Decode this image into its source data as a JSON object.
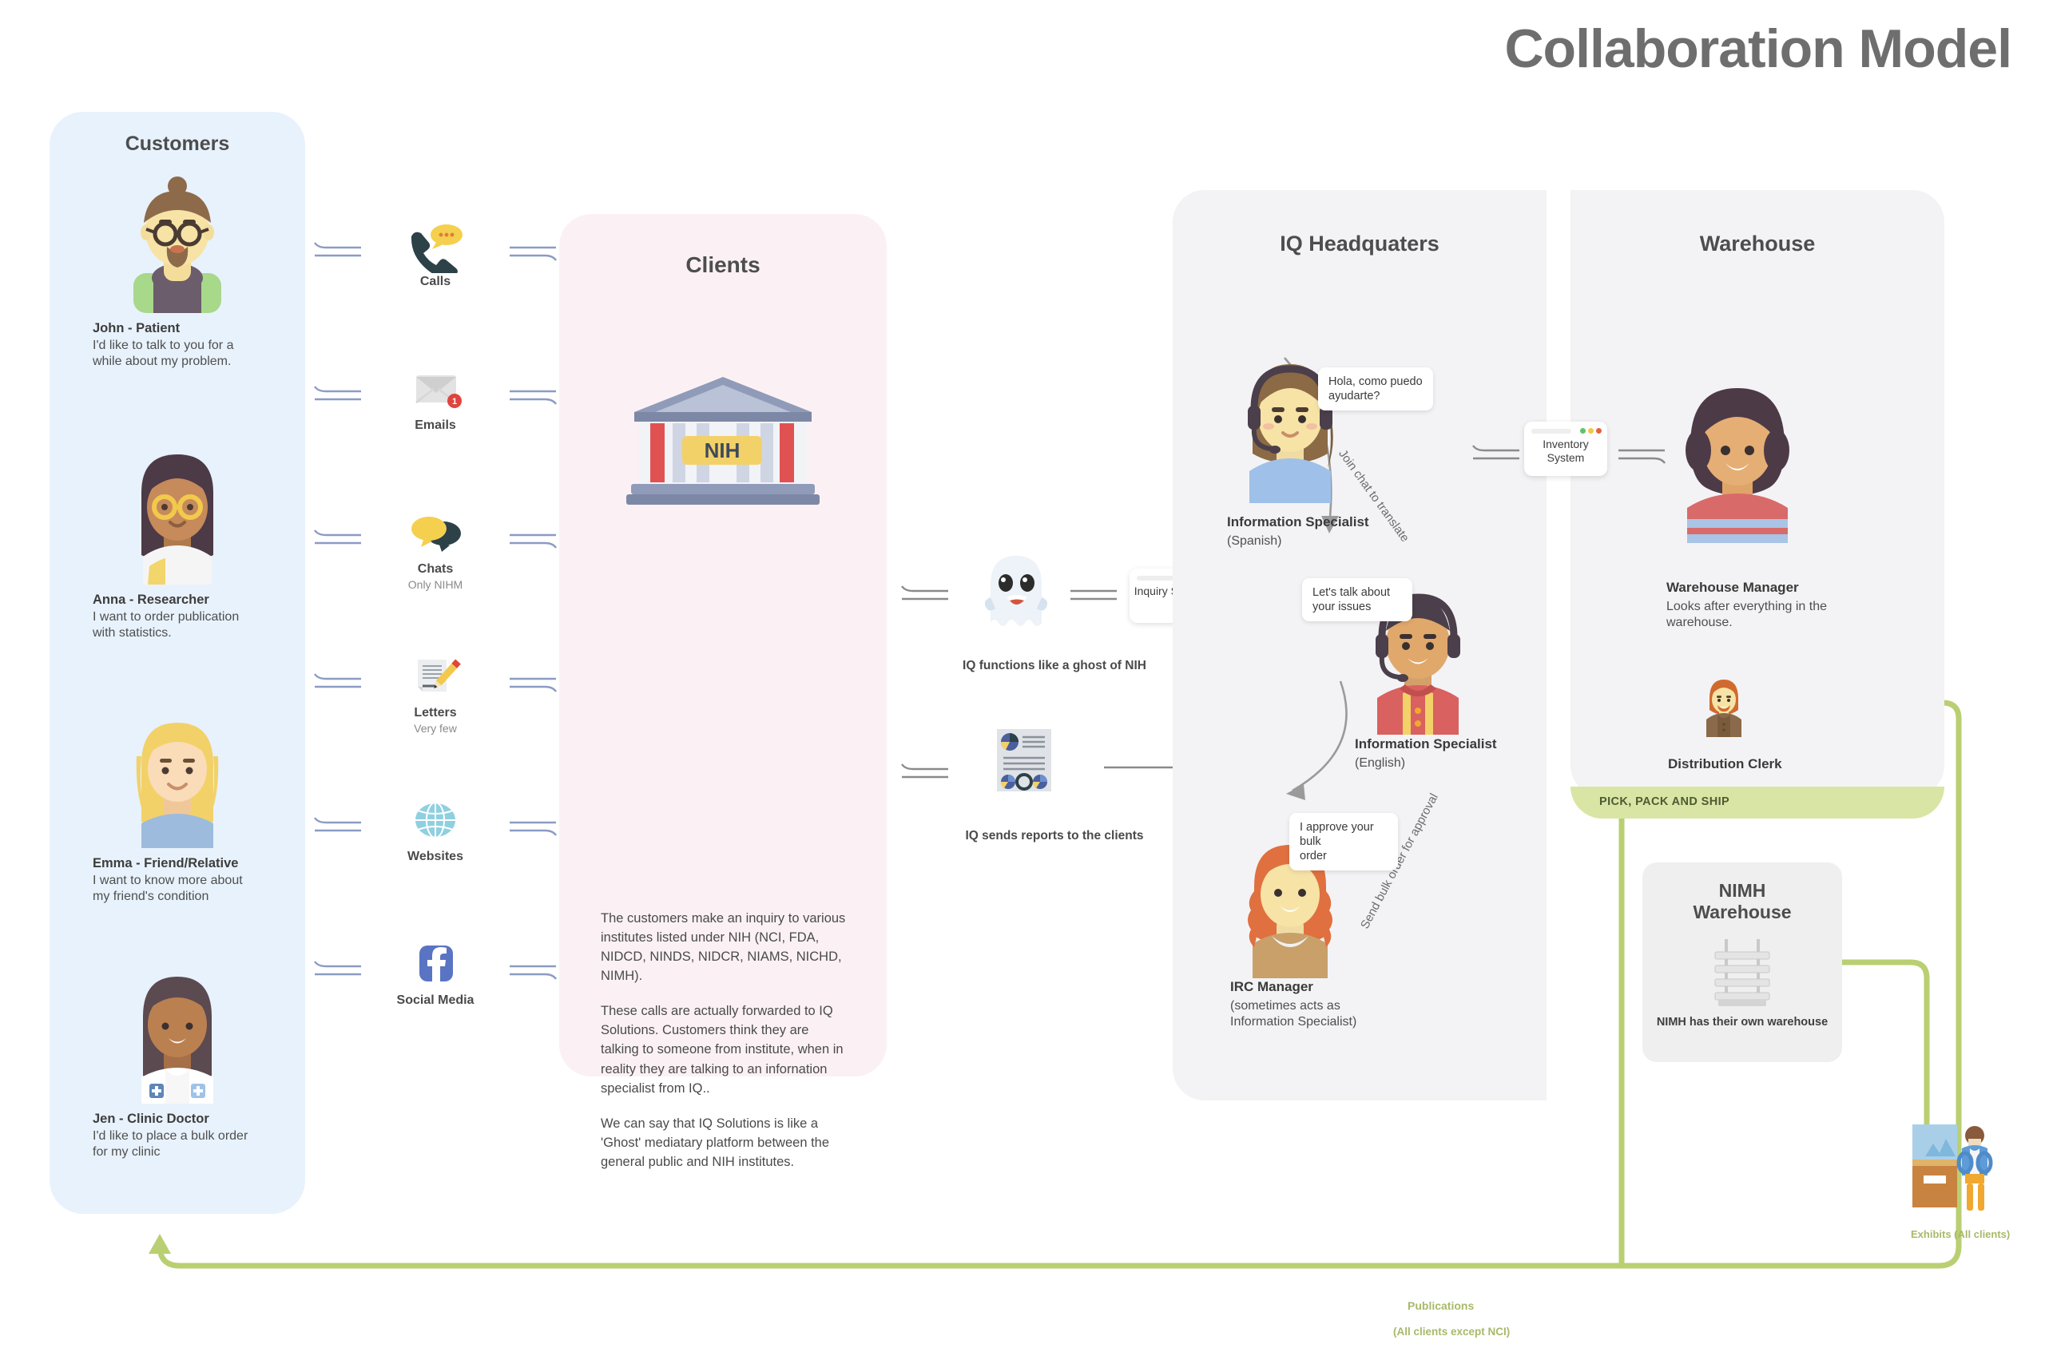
{
  "title": "Collaboration Model",
  "customers": {
    "heading": "Customers",
    "items": [
      {
        "name": "John - Patient",
        "desc": "I'd like to talk to you for a while about my problem.",
        "avatar": "john-avatar"
      },
      {
        "name": "Anna - Researcher",
        "desc": "I want to order publication with statistics.",
        "avatar": "anna-avatar"
      },
      {
        "name": "Emma - Friend/Relative",
        "desc": "I want to know more about my friend's condition",
        "avatar": "emma-avatar"
      },
      {
        "name": "Jen - Clinic Doctor",
        "desc": "I'd like to place a bulk order for my clinic",
        "avatar": "jen-avatar"
      }
    ]
  },
  "channels": [
    {
      "label": "Calls",
      "sub": "",
      "icon": "phone-icon"
    },
    {
      "label": "Emails",
      "sub": "",
      "icon": "envelope-icon"
    },
    {
      "label": "Chats",
      "sub": "Only NIHM",
      "icon": "chat-bubbles-icon"
    },
    {
      "label": "Letters",
      "sub": "Very few",
      "icon": "letter-pencil-icon"
    },
    {
      "label": "Websites",
      "sub": "",
      "icon": "globe-icon"
    },
    {
      "label": "Social Media",
      "sub": "",
      "icon": "facebook-icon"
    }
  ],
  "clients": {
    "heading": "Clients",
    "building_label": "NIH",
    "paragraphs": [
      "The customers make an inquiry to various institutes listed under NIH (NCI, FDA, NIDCD, NINDS, NIDCR, NIAMS, NICHD, NIMH).",
      "These calls are actually forwarded to IQ Solutions. Customers think they are talking to someone from institute, when in reality they are talking to an infornation specialist from IQ..",
      "We can say that IQ Solutions is like a 'Ghost' mediatary platform between the general public and NIH institutes."
    ],
    "ghost_quote": "'Ghost'"
  },
  "middle": {
    "ghost_caption": "IQ functions like a ghost of NIH",
    "inquiry_system": "Inquiry\nSystem",
    "reports_caption": "IQ sends reports to the clients"
  },
  "headquarters": {
    "heading": "IQ Headquaters",
    "specialist_spanish": {
      "name": "Information Specialist",
      "sub": "(Spanish)",
      "bubble": "Hola, como puedo\nayudarte?"
    },
    "specialist_english": {
      "name": "Information Specialist",
      "sub": "(English)",
      "bubble": "Let's talk about\nyour issues"
    },
    "irc_manager": {
      "name": "IRC Manager",
      "sub": "(sometimes acts as\nInformation Specialist)",
      "bubble": "I approve your bulk\norder"
    },
    "arrow_translate": "Join chat to translate",
    "arrow_bulk": "Send bulk order for approval"
  },
  "warehouse": {
    "heading": "Warehouse",
    "inventory_system": "Inventory\nSystem",
    "manager": {
      "name": "Warehouse Manager",
      "desc": "Looks after everything in the warehouse."
    },
    "clerk": {
      "name": "Distribution Clerk"
    },
    "pick_pack_ship": "PICK, PACK AND SHIP",
    "nimh": {
      "title": "NIMH\nWarehouse",
      "caption": "NIMH has their own warehouse"
    }
  },
  "flows": {
    "exhibits": "Exhibits (All clients)",
    "publications": "Publications",
    "publications_sub": "(All clients except NCI)"
  },
  "colors": {
    "customers_panel": "#e8f2fc",
    "clients_panel": "#fbf1f4",
    "hq_panel": "#f3f3f5",
    "green_flow": "#b9cf72",
    "pick_pack_bar": "#d9e5a4",
    "title_gray": "#6e6e6e"
  }
}
